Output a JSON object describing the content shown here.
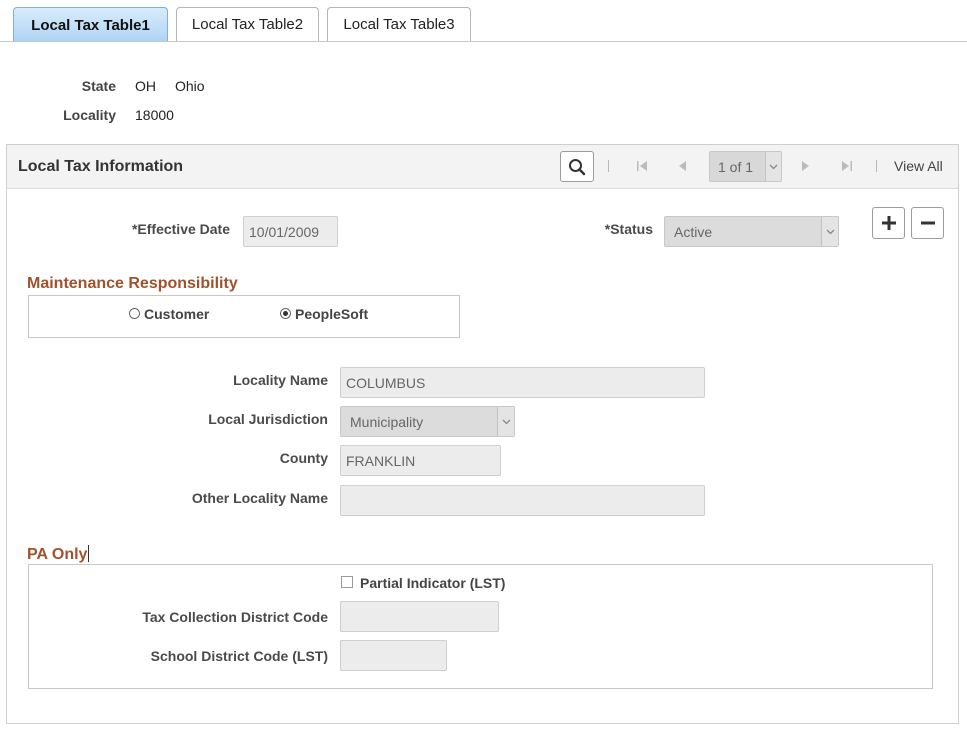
{
  "tabs": [
    {
      "label": "Local Tax Table1",
      "active": true
    },
    {
      "label": "Local Tax Table2",
      "active": false
    },
    {
      "label": "Local Tax Table3",
      "active": false
    }
  ],
  "header": {
    "state_label": "State",
    "state_code": "OH",
    "state_name": "Ohio",
    "locality_label": "Locality",
    "locality_value": "18000"
  },
  "group": {
    "title": "Local Tax Information",
    "search_icon": "search-icon",
    "pager": "1 of 1",
    "view_all": "View All"
  },
  "effdt": {
    "effective_date_label": "*Effective Date",
    "effective_date_value": "10/01/2009",
    "status_label": "*Status",
    "status_value": "Active"
  },
  "maintenance": {
    "title": "Maintenance Responsibility",
    "options": [
      {
        "label": "Customer",
        "selected": false
      },
      {
        "label": "PeopleSoft",
        "selected": true
      }
    ]
  },
  "details": {
    "locality_name_label": "Locality Name",
    "locality_name_value": "COLUMBUS",
    "local_jurisdiction_label": "Local Jurisdiction",
    "local_jurisdiction_value": "Municipality",
    "county_label": "County",
    "county_value": "FRANKLIN",
    "other_locality_label": "Other Locality Name",
    "other_locality_value": ""
  },
  "pa_only": {
    "title": "PA Only",
    "partial_indicator_label": "Partial Indicator (LST)",
    "partial_indicator_checked": false,
    "tax_collection_label": "Tax Collection District Code",
    "tax_collection_value": "",
    "school_district_label": "School District Code (LST)",
    "school_district_value": ""
  },
  "colors": {
    "section_title": "#a0522d",
    "active_tab": "#aed3f4"
  }
}
